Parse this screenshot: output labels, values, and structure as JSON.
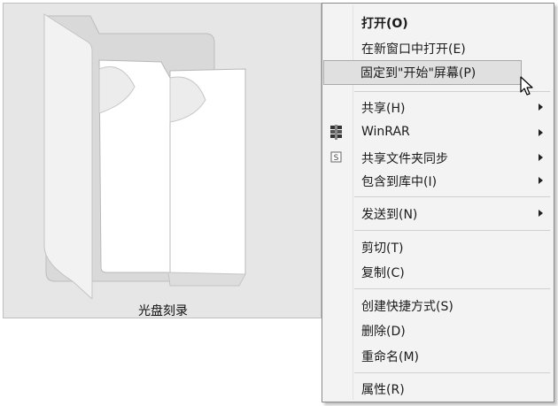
{
  "folder": {
    "caption": "光盘刻录"
  },
  "context_menu": {
    "items": [
      {
        "label": "打开(O)",
        "bold": true
      },
      {
        "label": "在新窗口中打开(E)"
      },
      {
        "label": "固定到\"开始\"屏幕(P)",
        "highlighted": true
      },
      {
        "label": "共享(H)",
        "submenu": true
      },
      {
        "label": "WinRAR",
        "submenu": true,
        "icon": "winrar-icon"
      },
      {
        "label": "共享文件夹同步",
        "submenu": true,
        "icon": "sync-s-icon"
      },
      {
        "label": "包含到库中(I)",
        "submenu": true
      },
      {
        "label": "发送到(N)",
        "submenu": true
      },
      {
        "label": "剪切(T)"
      },
      {
        "label": "复制(C)"
      },
      {
        "label": "创建快捷方式(S)"
      },
      {
        "label": "删除(D)"
      },
      {
        "label": "重命名(M)"
      },
      {
        "label": "属性(R)"
      }
    ]
  },
  "icons": {
    "winrar": "winrar-icon",
    "sync": "sync-s-icon",
    "cursor": "mouse-pointer-icon"
  }
}
